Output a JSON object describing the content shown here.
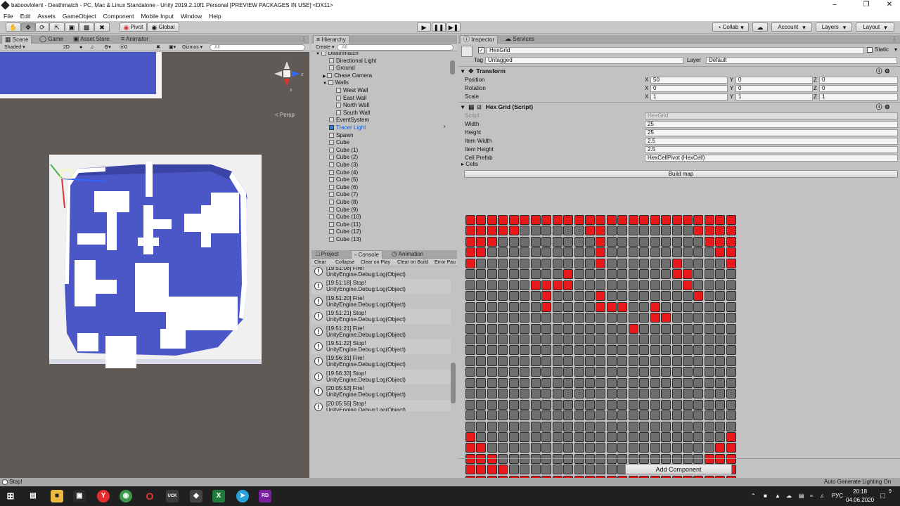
{
  "window": {
    "title": "baboovlolent - Deathmatch - PC, Mac & Linux Standalone - Unity 2019.2.10f1 Personal [PREVIEW PACKAGES IN USE] <DX11>"
  },
  "menu": [
    "File",
    "Edit",
    "Assets",
    "GameObject",
    "Component",
    "Mobile Input",
    "Window",
    "Help"
  ],
  "toolbar": {
    "pivot": "Pivot",
    "global": "Global",
    "collab": "Collab",
    "account": "Account",
    "layers": "Layers",
    "layout": "Layout"
  },
  "scene": {
    "tabs": [
      "Scene",
      "Game",
      "Asset Store",
      "Animator"
    ],
    "shading": "Shaded",
    "mode2d": "2D",
    "gizmos": "Gizmos",
    "search": "All",
    "fx_count": "0",
    "persp": "Persp"
  },
  "hierarchy": {
    "tab": "Hierarchy",
    "create": "Create",
    "search": "All",
    "items": [
      {
        "label": "Deathmatch",
        "depth": 0,
        "arrow": "▼"
      },
      {
        "label": "Directional Light",
        "depth": 1
      },
      {
        "label": "Ground",
        "depth": 1
      },
      {
        "label": "Chase Camera",
        "depth": 1,
        "arrow": "▶"
      },
      {
        "label": "Walls",
        "depth": 1,
        "arrow": "▼"
      },
      {
        "label": "West Wall",
        "depth": 2
      },
      {
        "label": "East Wall",
        "depth": 2
      },
      {
        "label": "North Wall",
        "depth": 2
      },
      {
        "label": "South Wall",
        "depth": 2
      },
      {
        "label": "EventSystem",
        "depth": 1
      },
      {
        "label": "Tracer Light",
        "depth": 1,
        "selected": true
      },
      {
        "label": "Spawn",
        "depth": 1
      },
      {
        "label": "Cube",
        "depth": 1
      },
      {
        "label": "Cube (1)",
        "depth": 1
      },
      {
        "label": "Cube (2)",
        "depth": 1
      },
      {
        "label": "Cube (3)",
        "depth": 1
      },
      {
        "label": "Cube (4)",
        "depth": 1
      },
      {
        "label": "Cube (5)",
        "depth": 1
      },
      {
        "label": "Cube (6)",
        "depth": 1
      },
      {
        "label": "Cube (7)",
        "depth": 1
      },
      {
        "label": "Cube (8)",
        "depth": 1
      },
      {
        "label": "Cube (9)",
        "depth": 1
      },
      {
        "label": "Cube (10)",
        "depth": 1
      },
      {
        "label": "Cube (11)",
        "depth": 1
      },
      {
        "label": "Cube (12)",
        "depth": 1
      },
      {
        "label": "Cube (13)",
        "depth": 1
      },
      {
        "label": "HexGrid",
        "depth": 1
      }
    ]
  },
  "console": {
    "tabs": [
      "Project",
      "Console",
      "Animation"
    ],
    "buttons": [
      "Clear",
      "Collapse",
      "Clear on Play",
      "Clear on Build",
      "Error Pau"
    ],
    "entries": [
      {
        "line1": "[19:51:08] Fire!",
        "line2": "UnityEngine.Debug:Log(Object)"
      },
      {
        "line1": "[19:51:18] Stop!",
        "line2": "UnityEngine.Debug:Log(Object)"
      },
      {
        "line1": "[19:51:20] Fire!",
        "line2": "UnityEngine.Debug:Log(Object)"
      },
      {
        "line1": "[19:51:21] Stop!",
        "line2": "UnityEngine.Debug:Log(Object)"
      },
      {
        "line1": "[19:51:21] Fire!",
        "line2": "UnityEngine.Debug:Log(Object)"
      },
      {
        "line1": "[19:51:22] Stop!",
        "line2": "UnityEngine.Debug:Log(Object)"
      },
      {
        "line1": "[19:56:31] Fire!",
        "line2": "UnityEngine.Debug:Log(Object)"
      },
      {
        "line1": "[19:56:33] Stop!",
        "line2": "UnityEngine.Debug:Log(Object)"
      },
      {
        "line1": "[20:05:53] Fire!",
        "line2": "UnityEngine.Debug:Log(Object)"
      },
      {
        "line1": "[20:05:56] Stop!",
        "line2": "UnityEngine.Debug:Log(Object)"
      }
    ]
  },
  "inspector": {
    "tabs": [
      "Inspector",
      "Services"
    ],
    "object_name": "HexGrid",
    "static": "Static",
    "tag_label": "Tag",
    "tag_value": "Untagged",
    "layer_label": "Layer",
    "layer_value": "Default",
    "transform": {
      "title": "Transform",
      "rows": [
        {
          "label": "Position",
          "x": "50",
          "y": "0",
          "z": "0"
        },
        {
          "label": "Rotation",
          "x": "0",
          "y": "0",
          "z": "0"
        },
        {
          "label": "Scale",
          "x": "1",
          "y": "1",
          "z": "1"
        }
      ]
    },
    "script": {
      "title": "Hex Grid (Script)",
      "rows": [
        {
          "label": "Script",
          "value": "HexGrid",
          "disabled": true
        },
        {
          "label": "Width",
          "value": "25"
        },
        {
          "label": "Height",
          "value": "25"
        },
        {
          "label": "Item Width",
          "value": "2.5"
        },
        {
          "label": "Item Height",
          "value": "2.5"
        },
        {
          "label": "Cell Prefab",
          "value": "HexCellPivot (HexCell)"
        }
      ],
      "cells_label": "Cells",
      "build_button": "Build map"
    },
    "grid": [
      "1111111111111111111111111",
      "1111100000011000000001111",
      "1110000000001000000000111",
      "1100000000001000000000011",
      "1000000000001000000100001",
      "0000000001000000000110000",
      "0000001111000000000010000",
      "0000000100001000000001000",
      "0000000100001110010000000",
      "0000000000000000011000000",
      "0000000000000001000000000",
      "0000000000000000000000000",
      "0000000000000000000000000",
      "0000000000000000000000000",
      "0000000000000000000000000",
      "0000000000000000000000000",
      "0000000000000000000000000",
      "0000000000000000000000000",
      "0000000000000000000000000",
      "0000000000000000000000000",
      "1000000000000000000000001",
      "1100000000000000000000011",
      "1110000000000000000000111",
      "1111000000000000000001111",
      "1111111111111111111111111"
    ],
    "add_component": "Add Component"
  },
  "colors": {
    "wall": "#e8181b",
    "floor": "#6e6e6e",
    "ground": "#4b57c7"
  },
  "status": {
    "message": "Stop!",
    "right": "Auto Generate Lighting On"
  },
  "taskbar": {
    "time": "20:18",
    "date": "04.06.2020",
    "lang": "РУС",
    "notify": "9"
  }
}
